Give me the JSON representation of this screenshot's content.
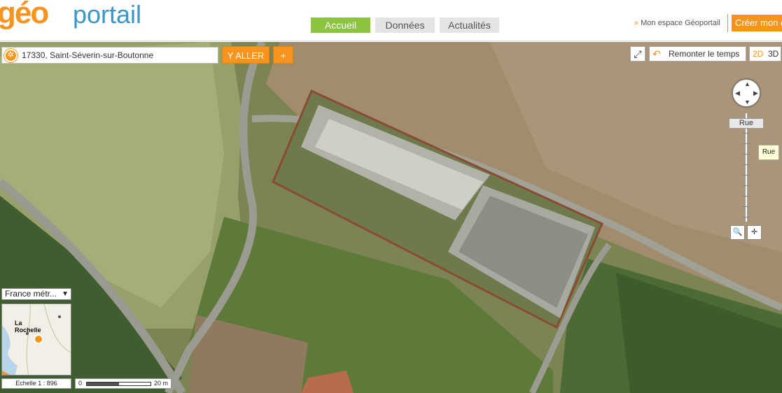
{
  "header": {
    "logo_geo": "géo",
    "logo_portail": "portail",
    "tabs": [
      {
        "label": "Accueil",
        "active": true
      },
      {
        "label": "Données",
        "active": false
      },
      {
        "label": "Actualités",
        "active": false
      }
    ],
    "espace_prefix": "»",
    "espace_label": "Mon espace Géoportail",
    "creer_label": "Créer mon e"
  },
  "search": {
    "value": "17330, Saint-Séverin-sur-Boutonne",
    "go_label": "Y ALLER",
    "add_label": "+"
  },
  "map_controls": {
    "remonter_label": "Remonter le temps",
    "mode_2d": "2D",
    "mode_3d": "3D",
    "zoom_level_label": "Rue",
    "tooltip": "Rue",
    "fullscreen_icon": "expand-icon",
    "pan_icon": "pan-arrows-icon"
  },
  "minimap": {
    "territory_label": "France métr...",
    "city_label_1": "La",
    "city_label_2": "Rochelle"
  },
  "scale": {
    "echelle_label": "Echelle 1 :  896",
    "zero": "0",
    "distance": "20 m"
  },
  "colors": {
    "accent_green": "#8bc53f",
    "accent_orange": "#f7941d",
    "logo_blue": "#3a96c8"
  }
}
